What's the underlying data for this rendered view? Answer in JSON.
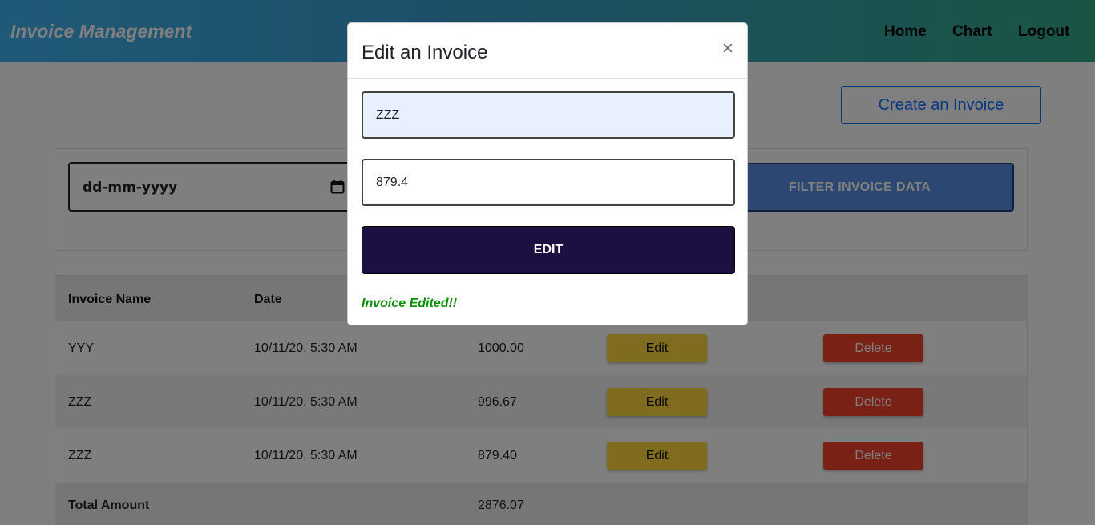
{
  "navbar": {
    "brand": "Invoice Management",
    "links": [
      "Home",
      "Chart",
      "Logout"
    ]
  },
  "page": {
    "create_button": "Create an Invoice",
    "filter": {
      "date_placeholder": "dd-mm-yyyy",
      "button_label": "FILTER INVOICE DATA"
    },
    "table": {
      "headers": [
        "Invoice Name",
        "Date"
      ],
      "rows": [
        {
          "name": "YYY",
          "date": "10/11/20, 5:30 AM",
          "amount": "1000.00",
          "edit": "Edit",
          "delete": "Delete"
        },
        {
          "name": "ZZZ",
          "date": "10/11/20, 5:30 AM",
          "amount": "996.67",
          "edit": "Edit",
          "delete": "Delete"
        },
        {
          "name": "ZZZ",
          "date": "10/11/20, 5:30 AM",
          "amount": "879.40",
          "edit": "Edit",
          "delete": "Delete"
        }
      ],
      "total_label": "Total Amount",
      "total_value": "2876.07"
    }
  },
  "modal": {
    "title": "Edit an Invoice",
    "close": "×",
    "name_value": "ZZZ",
    "amount_value": "879.4",
    "submit_label": "EDIT",
    "message": "Invoice Edited!!"
  },
  "colors": {
    "edit_button": "#ffd83c",
    "delete_button": "#f4432d",
    "modal_submit": "#1c1042",
    "success": "#0a8f0a"
  }
}
